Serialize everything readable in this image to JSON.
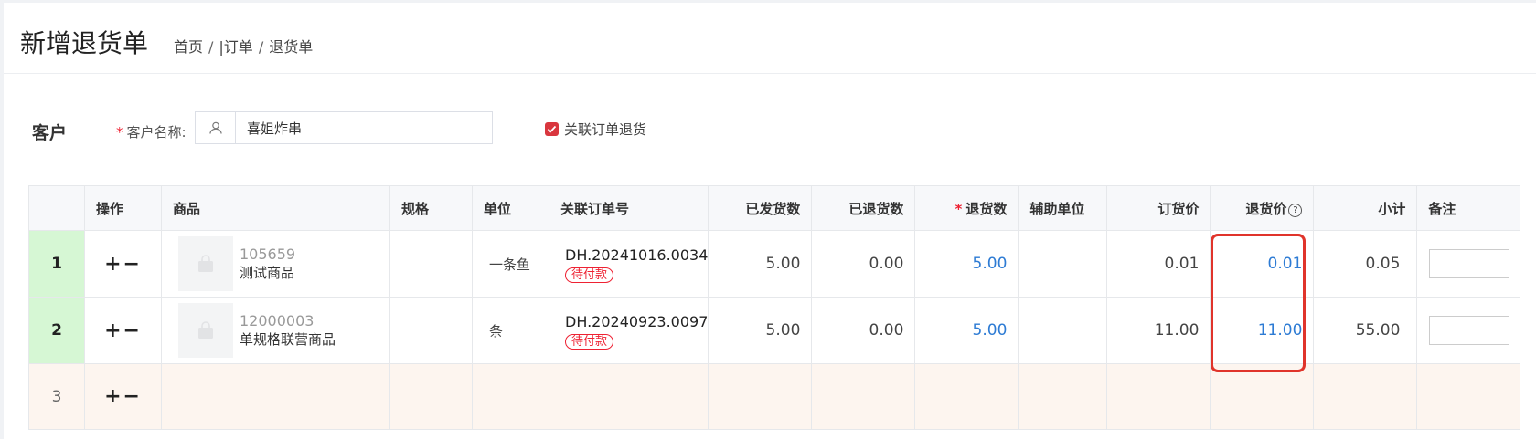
{
  "header": {
    "title": "新增退货单",
    "breadcrumb": [
      "首页",
      "|订单",
      "退货单"
    ]
  },
  "customer": {
    "section_title": "客户",
    "name_label": "客户名称:",
    "name_value": "喜姐炸串",
    "link_order_label": "关联订单退货",
    "link_order_checked": true
  },
  "table": {
    "columns": [
      "操作",
      "商品",
      "规格",
      "单位",
      "关联订单号",
      "已发货数",
      "已退货数",
      "退货数",
      "辅助单位",
      "订货价",
      "退货价",
      "小计",
      "备注"
    ],
    "ops_symbol": "+−",
    "rows": [
      {
        "index": "1",
        "code": "105659",
        "name": "测试商品",
        "spec": "",
        "unit": "一条鱼",
        "order_no": "DH.20241016.0034",
        "status": "待付款",
        "shipped": "5.00",
        "returned": "0.00",
        "return_qty": "5.00",
        "aux_unit": "",
        "order_price": "0.01",
        "return_price": "0.01",
        "subtotal": "0.05"
      },
      {
        "index": "2",
        "code": "12000003",
        "name": "单规格联营商品",
        "spec": "",
        "unit": "条",
        "order_no": "DH.20240923.0097",
        "status": "待付款",
        "shipped": "5.00",
        "returned": "0.00",
        "return_qty": "5.00",
        "aux_unit": "",
        "order_price": "11.00",
        "return_price": "11.00",
        "subtotal": "55.00"
      }
    ],
    "empty_row_index": "3"
  },
  "colors": {
    "accent_red": "#e23333",
    "link_blue": "#2d7bd4",
    "row_green": "#d6f7d4",
    "empty_row": "#fdf5ef",
    "highlight_red": "#e0342b"
  }
}
